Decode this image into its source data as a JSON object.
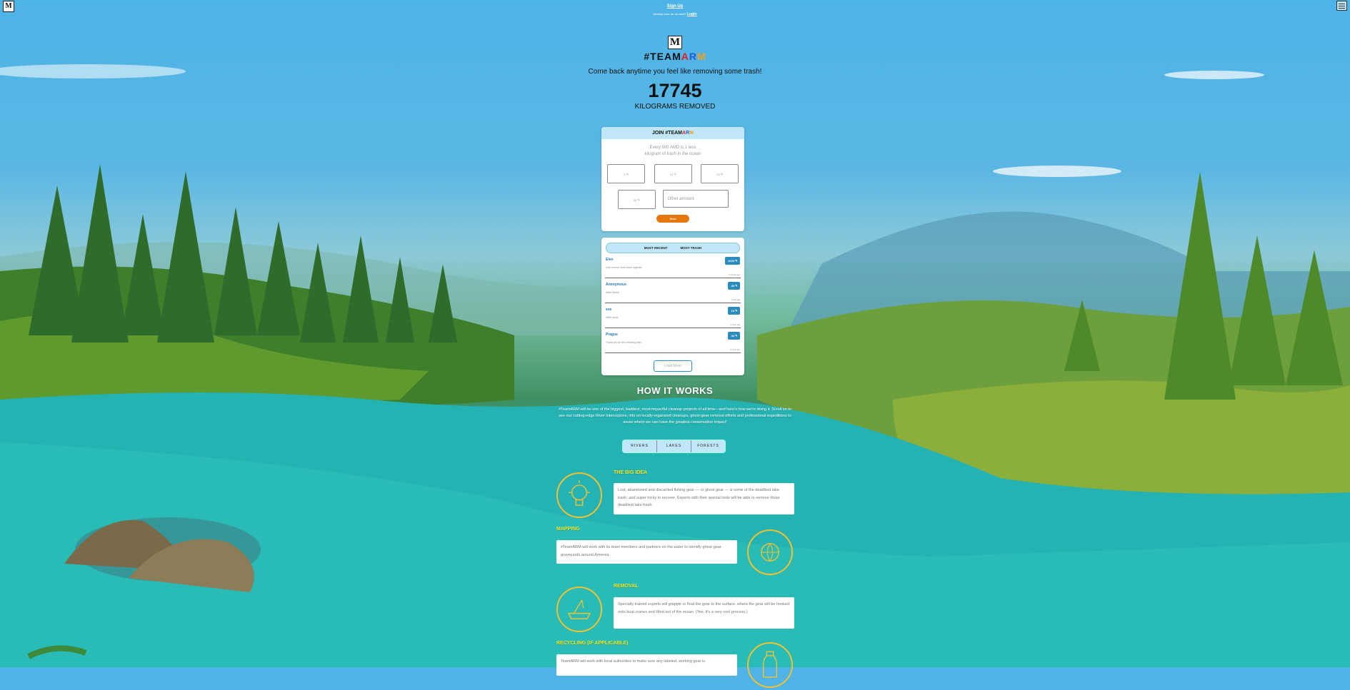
{
  "header": {
    "logo_letter": "M",
    "signup": "Sign Up",
    "have_account": "Already have an account?",
    "login": "Login"
  },
  "hero": {
    "brand_prefix": "#TEAM",
    "brand_a": "A",
    "brand_r": "R",
    "brand_m": "M",
    "tagline": "Come back anytime you feel like removing some trash!",
    "count": "17745",
    "unit": "KILOGRAMS REMOVED"
  },
  "join": {
    "title_prefix": "JOIN #TEAM",
    "title_a": "A",
    "title_r": "R",
    "title_m": "M",
    "subtitle_line1": "Every 500 AMD is 1 less",
    "subtitle_line2": "kilogram of trash in the ocean",
    "amounts": [
      "2 ֏",
      "10 ֏",
      "25 ֏",
      "50 ֏"
    ],
    "other_placeholder": "Other amount",
    "next_label": "Next"
  },
  "feed": {
    "tab_recent": "MOST RECENT",
    "tab_trash": "MOST TRASH",
    "donations": [
      {
        "name": "Elen",
        "message": "Lets remove more trash together",
        "amount": "1000 ֏",
        "time": "6 minutes ago"
      },
      {
        "name": "Anonymous",
        "message": "Hello World!",
        "amount": "30 ֏",
        "time": "1 hour ago"
      },
      {
        "name": "eve",
        "message": "Hello world",
        "amount": "10 ֏",
        "time": "2 hours ago"
      },
      {
        "name": "Prague",
        "message": "Thank you for this amazing plan",
        "amount": "30 ֏",
        "time": "3 hours ago"
      }
    ],
    "load_more": "Load More"
  },
  "how": {
    "title": "HOW IT WORKS",
    "body": "#TeamARM will be one of the biggest, baddest, most-impactful cleanup projects of all time—and here's how we're doing it. Scroll on to see our cutting-edge River Interceptors, info on locally-organized cleanups, ghost-gear removal efforts and professional expeditions to areas where we can have the greatest conservation impact!",
    "tabs": [
      "RIVERS",
      "LAKES",
      "FORESTS"
    ]
  },
  "steps": [
    {
      "title": "THE BIG IDEA",
      "text": "Lost, abandoned and discarded fishing gear — or ghost gear — is some of the deadliest lake trash, and super tricky to recover. Experts with their special tools will be able to remove those deadliest lake trash."
    },
    {
      "title": "MAPPING",
      "text": "#TeamARM will work with its team members and partners on the water to identify ghost-gear graveyards around Armenia."
    },
    {
      "title": "REMOVAL",
      "text": "Specially trained experts will grapple or float the gear to the surface, where the gear will be hooked onto boat cranes and lifted out of the ocean. (Yes, it's a very cool process.)"
    },
    {
      "title": "RECYCLING (IF APPLICABLE)",
      "text": "TeamARM will work with local authorities to make sure any labeled, working gear is"
    }
  ],
  "colors": {
    "accent_orange": "#e5770f",
    "badge_blue": "#2a8bbf",
    "step_yellow": "#f3e51a"
  }
}
